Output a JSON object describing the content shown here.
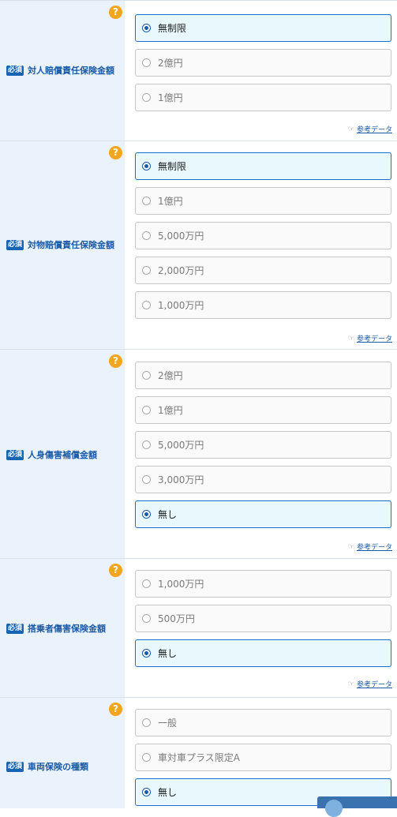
{
  "required_badge": "必須",
  "help_glyph": "?",
  "ref_link": "参考データ",
  "ref_icon": "pointing-hand-icon",
  "sections": [
    {
      "label": "対人賠償責任保険金額",
      "options": [
        "無制限",
        "2億円",
        "1億円"
      ],
      "selected": 0,
      "has_ref": true
    },
    {
      "label": "対物賠償責任保険金額",
      "options": [
        "無制限",
        "1億円",
        "5,000万円",
        "2,000万円",
        "1,000万円"
      ],
      "selected": 0,
      "has_ref": true
    },
    {
      "label": "人身傷害補償金額",
      "options": [
        "2億円",
        "1億円",
        "5,000万円",
        "3,000万円",
        "無し"
      ],
      "selected": 4,
      "has_ref": true
    },
    {
      "label": "搭乗者傷害保険金額",
      "options": [
        "1,000万円",
        "500万円",
        "無し"
      ],
      "selected": 2,
      "has_ref": true
    },
    {
      "label": "車両保険の種類",
      "options": [
        "一般",
        "車対車プラス限定A",
        "無し"
      ],
      "selected": 2,
      "has_ref": false
    }
  ],
  "colors": {
    "accent": "#1a5aa6",
    "selected_bg": "#e8f8fd",
    "label_bg": "#eaf2fb",
    "help": "#f3a51b"
  }
}
